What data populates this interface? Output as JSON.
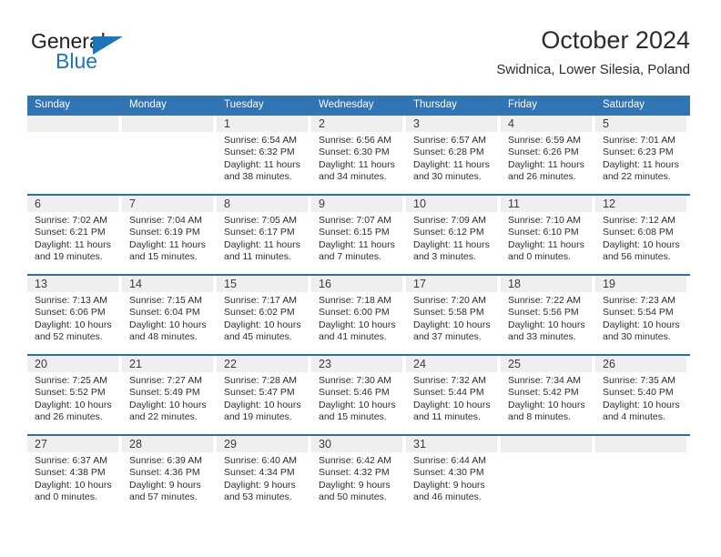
{
  "brand": {
    "name_top": "General",
    "name_bottom": "Blue",
    "accent_color": "#1b75bb",
    "triangle_icon": "blue-triangle-icon"
  },
  "header": {
    "title": "October 2024",
    "subtitle": "Swidnica, Lower Silesia, Poland"
  },
  "theme": {
    "header_blue": "#3174b4",
    "row_border_blue": "#2e6da9",
    "daynum_band": "#efefef"
  },
  "weekday_headers": [
    "Sunday",
    "Monday",
    "Tuesday",
    "Wednesday",
    "Thursday",
    "Friday",
    "Saturday"
  ],
  "weeks": [
    [
      {
        "day": "",
        "lines": []
      },
      {
        "day": "",
        "lines": []
      },
      {
        "day": "1",
        "lines": [
          "Sunrise: 6:54 AM",
          "Sunset: 6:32 PM",
          "Daylight: 11 hours",
          "and 38 minutes."
        ]
      },
      {
        "day": "2",
        "lines": [
          "Sunrise: 6:56 AM",
          "Sunset: 6:30 PM",
          "Daylight: 11 hours",
          "and 34 minutes."
        ]
      },
      {
        "day": "3",
        "lines": [
          "Sunrise: 6:57 AM",
          "Sunset: 6:28 PM",
          "Daylight: 11 hours",
          "and 30 minutes."
        ]
      },
      {
        "day": "4",
        "lines": [
          "Sunrise: 6:59 AM",
          "Sunset: 6:26 PM",
          "Daylight: 11 hours",
          "and 26 minutes."
        ]
      },
      {
        "day": "5",
        "lines": [
          "Sunrise: 7:01 AM",
          "Sunset: 6:23 PM",
          "Daylight: 11 hours",
          "and 22 minutes."
        ]
      }
    ],
    [
      {
        "day": "6",
        "lines": [
          "Sunrise: 7:02 AM",
          "Sunset: 6:21 PM",
          "Daylight: 11 hours",
          "and 19 minutes."
        ]
      },
      {
        "day": "7",
        "lines": [
          "Sunrise: 7:04 AM",
          "Sunset: 6:19 PM",
          "Daylight: 11 hours",
          "and 15 minutes."
        ]
      },
      {
        "day": "8",
        "lines": [
          "Sunrise: 7:05 AM",
          "Sunset: 6:17 PM",
          "Daylight: 11 hours",
          "and 11 minutes."
        ]
      },
      {
        "day": "9",
        "lines": [
          "Sunrise: 7:07 AM",
          "Sunset: 6:15 PM",
          "Daylight: 11 hours",
          "and 7 minutes."
        ]
      },
      {
        "day": "10",
        "lines": [
          "Sunrise: 7:09 AM",
          "Sunset: 6:12 PM",
          "Daylight: 11 hours",
          "and 3 minutes."
        ]
      },
      {
        "day": "11",
        "lines": [
          "Sunrise: 7:10 AM",
          "Sunset: 6:10 PM",
          "Daylight: 11 hours",
          "and 0 minutes."
        ]
      },
      {
        "day": "12",
        "lines": [
          "Sunrise: 7:12 AM",
          "Sunset: 6:08 PM",
          "Daylight: 10 hours",
          "and 56 minutes."
        ]
      }
    ],
    [
      {
        "day": "13",
        "lines": [
          "Sunrise: 7:13 AM",
          "Sunset: 6:06 PM",
          "Daylight: 10 hours",
          "and 52 minutes."
        ]
      },
      {
        "day": "14",
        "lines": [
          "Sunrise: 7:15 AM",
          "Sunset: 6:04 PM",
          "Daylight: 10 hours",
          "and 48 minutes."
        ]
      },
      {
        "day": "15",
        "lines": [
          "Sunrise: 7:17 AM",
          "Sunset: 6:02 PM",
          "Daylight: 10 hours",
          "and 45 minutes."
        ]
      },
      {
        "day": "16",
        "lines": [
          "Sunrise: 7:18 AM",
          "Sunset: 6:00 PM",
          "Daylight: 10 hours",
          "and 41 minutes."
        ]
      },
      {
        "day": "17",
        "lines": [
          "Sunrise: 7:20 AM",
          "Sunset: 5:58 PM",
          "Daylight: 10 hours",
          "and 37 minutes."
        ]
      },
      {
        "day": "18",
        "lines": [
          "Sunrise: 7:22 AM",
          "Sunset: 5:56 PM",
          "Daylight: 10 hours",
          "and 33 minutes."
        ]
      },
      {
        "day": "19",
        "lines": [
          "Sunrise: 7:23 AM",
          "Sunset: 5:54 PM",
          "Daylight: 10 hours",
          "and 30 minutes."
        ]
      }
    ],
    [
      {
        "day": "20",
        "lines": [
          "Sunrise: 7:25 AM",
          "Sunset: 5:52 PM",
          "Daylight: 10 hours",
          "and 26 minutes."
        ]
      },
      {
        "day": "21",
        "lines": [
          "Sunrise: 7:27 AM",
          "Sunset: 5:49 PM",
          "Daylight: 10 hours",
          "and 22 minutes."
        ]
      },
      {
        "day": "22",
        "lines": [
          "Sunrise: 7:28 AM",
          "Sunset: 5:47 PM",
          "Daylight: 10 hours",
          "and 19 minutes."
        ]
      },
      {
        "day": "23",
        "lines": [
          "Sunrise: 7:30 AM",
          "Sunset: 5:46 PM",
          "Daylight: 10 hours",
          "and 15 minutes."
        ]
      },
      {
        "day": "24",
        "lines": [
          "Sunrise: 7:32 AM",
          "Sunset: 5:44 PM",
          "Daylight: 10 hours",
          "and 11 minutes."
        ]
      },
      {
        "day": "25",
        "lines": [
          "Sunrise: 7:34 AM",
          "Sunset: 5:42 PM",
          "Daylight: 10 hours",
          "and 8 minutes."
        ]
      },
      {
        "day": "26",
        "lines": [
          "Sunrise: 7:35 AM",
          "Sunset: 5:40 PM",
          "Daylight: 10 hours",
          "and 4 minutes."
        ]
      }
    ],
    [
      {
        "day": "27",
        "lines": [
          "Sunrise: 6:37 AM",
          "Sunset: 4:38 PM",
          "Daylight: 10 hours",
          "and 0 minutes."
        ]
      },
      {
        "day": "28",
        "lines": [
          "Sunrise: 6:39 AM",
          "Sunset: 4:36 PM",
          "Daylight: 9 hours",
          "and 57 minutes."
        ]
      },
      {
        "day": "29",
        "lines": [
          "Sunrise: 6:40 AM",
          "Sunset: 4:34 PM",
          "Daylight: 9 hours",
          "and 53 minutes."
        ]
      },
      {
        "day": "30",
        "lines": [
          "Sunrise: 6:42 AM",
          "Sunset: 4:32 PM",
          "Daylight: 9 hours",
          "and 50 minutes."
        ]
      },
      {
        "day": "31",
        "lines": [
          "Sunrise: 6:44 AM",
          "Sunset: 4:30 PM",
          "Daylight: 9 hours",
          "and 46 minutes."
        ]
      },
      {
        "day": "",
        "lines": []
      },
      {
        "day": "",
        "lines": []
      }
    ]
  ]
}
